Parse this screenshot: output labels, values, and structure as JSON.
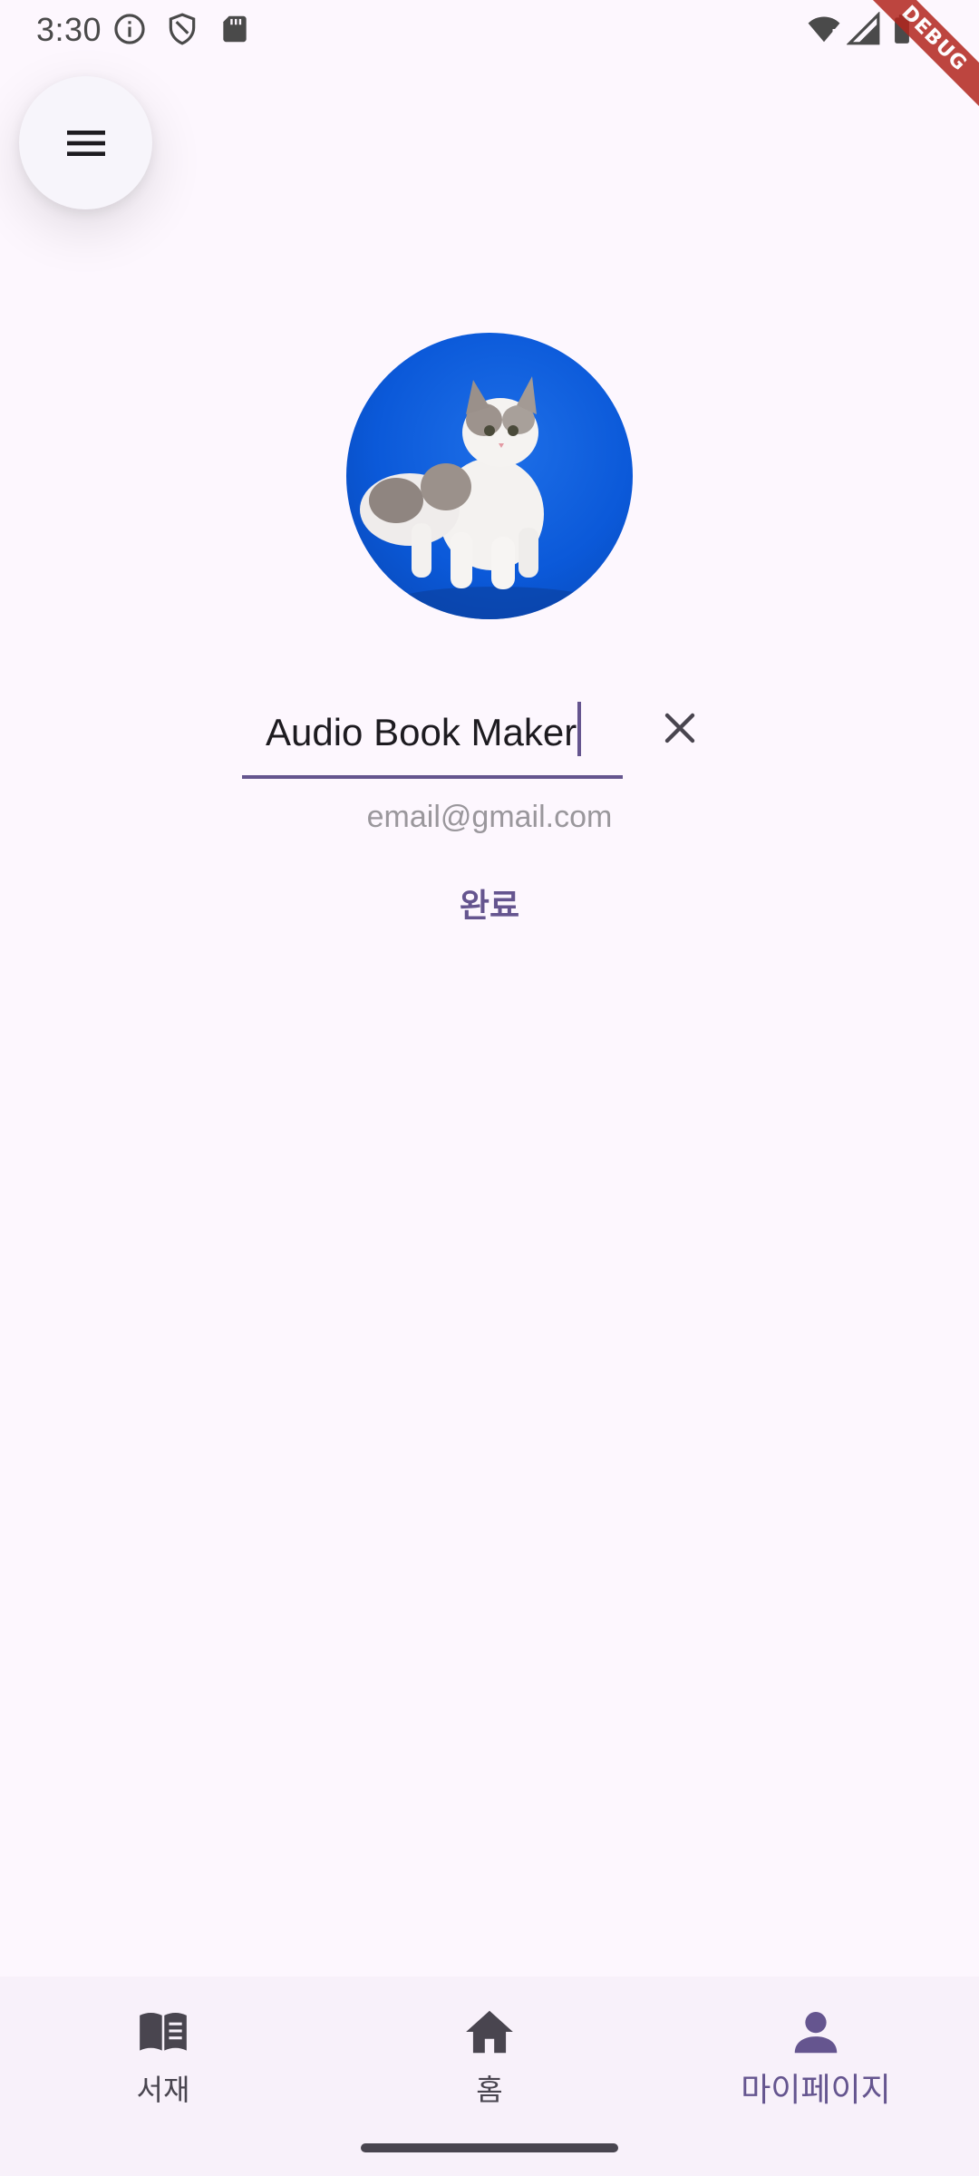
{
  "status_bar": {
    "time": "3:30",
    "icons_left": [
      "info-icon",
      "shield-icon",
      "sd-card-icon"
    ],
    "icons_right": [
      "wifi-alert-icon",
      "signal-icon",
      "battery-icon"
    ]
  },
  "debug_banner": {
    "label": "DEBUG"
  },
  "menu_button": {
    "icon": "menu-icon"
  },
  "profile": {
    "avatar": "kitten-photo",
    "name_value": "Audio Book Maker",
    "email": "email@gmail.com",
    "done_label": "완료",
    "clear_icon": "close-icon"
  },
  "bottom_nav": {
    "items": [
      {
        "label": "서재",
        "icon": "book-icon",
        "active": false
      },
      {
        "label": "홈",
        "icon": "home-icon",
        "active": false
      },
      {
        "label": "마이페이지",
        "icon": "person-icon",
        "active": true
      }
    ]
  },
  "colors": {
    "background": "#fdf7fe",
    "accent": "#65558f",
    "nav_background": "#f8f1fa",
    "avatar_background": "#0b59d9"
  }
}
